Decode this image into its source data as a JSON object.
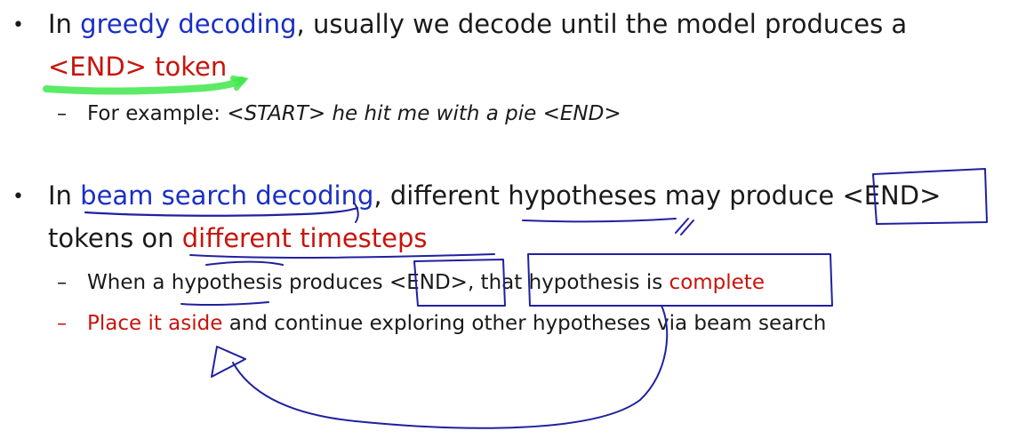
{
  "bullet1": {
    "marker": "•",
    "prefix": "In ",
    "term": "greedy decoding",
    "middle": ", usually we decode until the model produces a",
    "end_token": "<END> token",
    "sub1": {
      "marker": "–",
      "prefix": "For example: ",
      "example": "<START> he hit me with a pie <END>"
    }
  },
  "bullet2": {
    "marker": "•",
    "prefix": "In ",
    "term": "beam search decoding",
    "middle1": ", different ",
    "hypotheses": "hypotheses",
    "middle2": " may produce ",
    "end_token": "<END>",
    "line2_prefix": "tokens on ",
    "timesteps": "different timesteps",
    "sub1": {
      "marker": "–",
      "part1": "When a ",
      "hypothesis": "hypothesis",
      "part2": " produces ",
      "end_token": "<END>",
      "part3": ", that hypothesis is ",
      "complete": "complete"
    },
    "sub2": {
      "marker": "–",
      "place": "Place it aside",
      "rest": " and continue exploring other hypotheses via beam search"
    }
  },
  "colors": {
    "text": "#1a1a1a",
    "term_blue": "#1a2fc4",
    "emphasis_red": "#c8140c",
    "ink_blue": "#2020a0",
    "ink_green": "#3ee84a"
  }
}
